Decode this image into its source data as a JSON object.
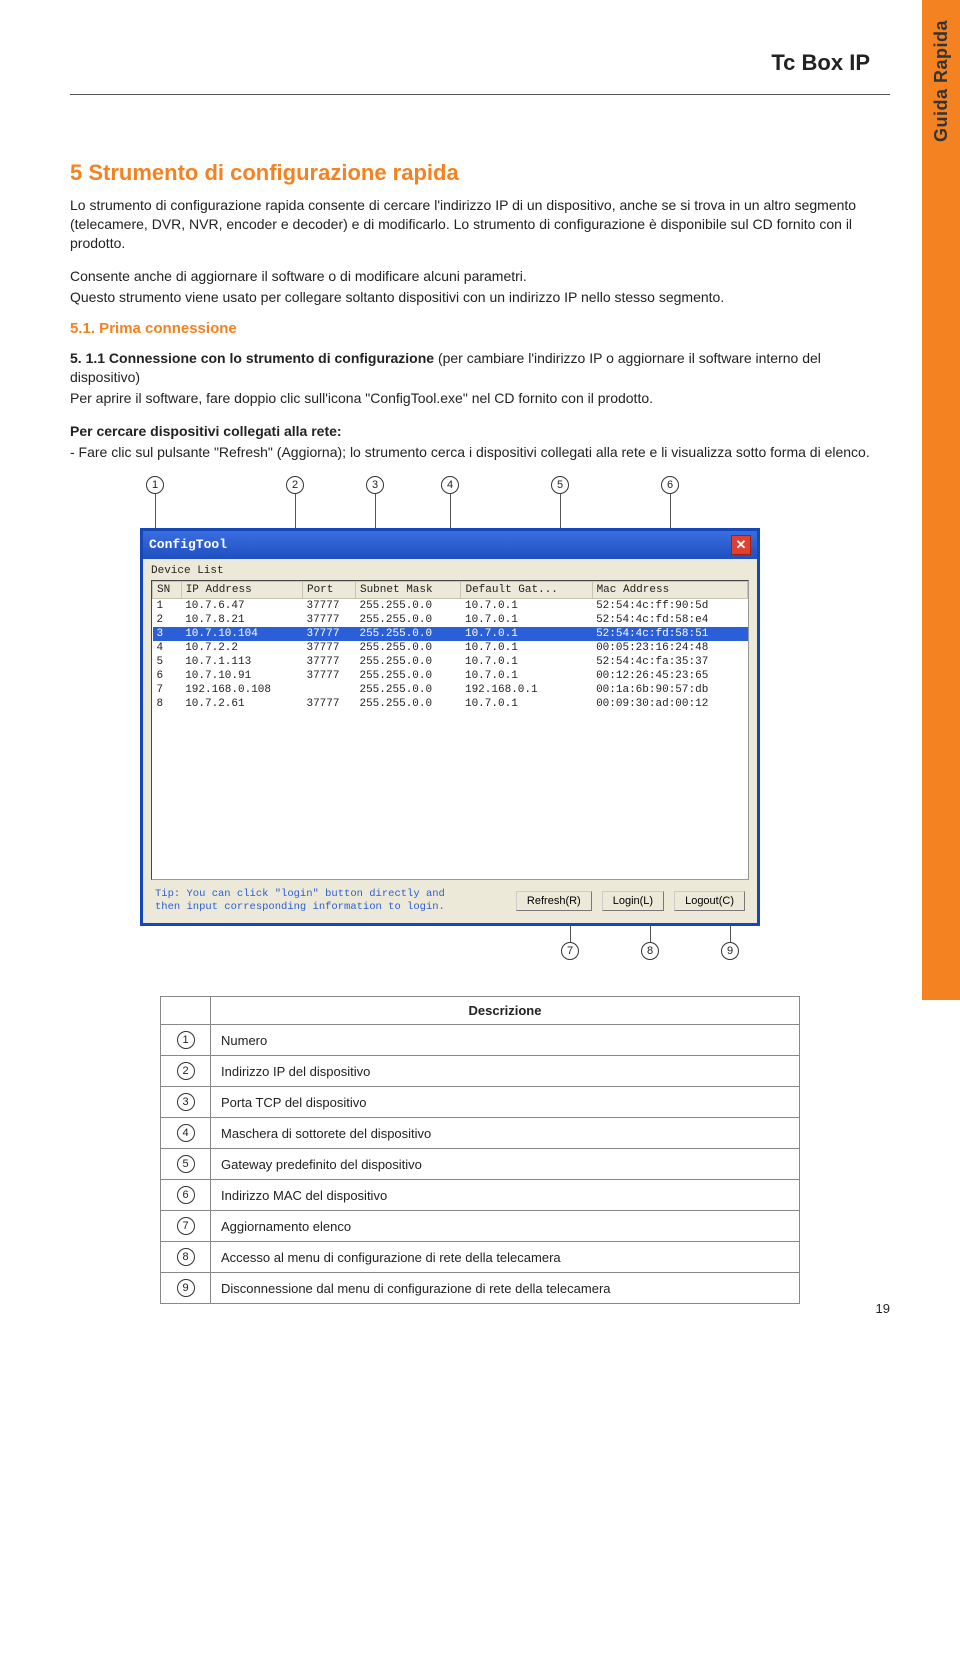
{
  "side_tab": "Guida Rapida",
  "header_title": "Tc Box IP",
  "h1": "5 Strumento di configurazione rapida",
  "p1": "Lo strumento di configurazione rapida consente di cercare l'indirizzo IP di un dispositivo, anche se si trova in un altro segmento (telecamere, DVR, NVR, encoder e decoder) e di modificarlo. Lo strumento di configurazione è disponibile sul CD fornito con il prodotto.",
  "p2": "Consente anche di aggiornare il software o di modificare alcuni parametri.",
  "p3": "Questo strumento viene usato per collegare soltanto dispositivi con un indirizzo IP nello stesso segmento.",
  "h2": "5.1. Prima connessione",
  "p4_lead": "5. 1.1 Connessione con lo strumento di configurazione",
  "p4_rest": " (per cambiare l'indirizzo IP o aggiornare il software interno del dispositivo)",
  "p5": "Per aprire il software, fare doppio clic sull'icona \"ConfigTool.exe\" nel CD fornito con il prodotto.",
  "p6_lead": "Per cercare dispositivi collegati alla rete:",
  "p6_rest": "- Fare clic sul pulsante \"Refresh\" (Aggiorna); lo strumento cerca i dispositivi collegati alla rete e li visualizza sotto forma di elenco.",
  "callouts_top": [
    "1",
    "2",
    "3",
    "4",
    "5",
    "6"
  ],
  "config_window": {
    "title": "ConfigTool",
    "list_label": "Device List",
    "headers": [
      "SN",
      "IP Address",
      "Port",
      "Subnet Mask",
      "Default Gat...",
      "Mac Address"
    ],
    "rows": [
      {
        "sn": "1",
        "ip": "10.7.6.47",
        "port": "37777",
        "mask": "255.255.0.0",
        "gw": "10.7.0.1",
        "mac": "52:54:4c:ff:90:5d"
      },
      {
        "sn": "2",
        "ip": "10.7.8.21",
        "port": "37777",
        "mask": "255.255.0.0",
        "gw": "10.7.0.1",
        "mac": "52:54:4c:fd:58:e4"
      },
      {
        "sn": "3",
        "ip": "10.7.10.104",
        "port": "37777",
        "mask": "255.255.0.0",
        "gw": "10.7.0.1",
        "mac": "52:54:4c:fd:58:51",
        "selected": true
      },
      {
        "sn": "4",
        "ip": "10.7.2.2",
        "port": "37777",
        "mask": "255.255.0.0",
        "gw": "10.7.0.1",
        "mac": "00:05:23:16:24:48"
      },
      {
        "sn": "5",
        "ip": "10.7.1.113",
        "port": "37777",
        "mask": "255.255.0.0",
        "gw": "10.7.0.1",
        "mac": "52:54:4c:fa:35:37"
      },
      {
        "sn": "6",
        "ip": "10.7.10.91",
        "port": "37777",
        "mask": "255.255.0.0",
        "gw": "10.7.0.1",
        "mac": "00:12:26:45:23:65"
      },
      {
        "sn": "7",
        "ip": "192.168.0.108",
        "port": "",
        "mask": "255.255.0.0",
        "gw": "192.168.0.1",
        "mac": "00:1a:6b:90:57:db"
      },
      {
        "sn": "8",
        "ip": "10.7.2.61",
        "port": "37777",
        "mask": "255.255.0.0",
        "gw": "10.7.0.1",
        "mac": "00:09:30:ad:00:12"
      }
    ],
    "tip": "Tip: You can click \"login\" button directly and then input corresponding information to login.",
    "buttons": {
      "refresh": "Refresh(R)",
      "login": "Login(L)",
      "logout": "Logout(C)"
    }
  },
  "callouts_bot": [
    "7",
    "8",
    "9"
  ],
  "desc_table": {
    "header": "Descrizione",
    "rows": [
      {
        "n": "1",
        "d": "Numero"
      },
      {
        "n": "2",
        "d": "Indirizzo IP del dispositivo"
      },
      {
        "n": "3",
        "d": "Porta TCP del dispositivo"
      },
      {
        "n": "4",
        "d": "Maschera di sottorete del dispositivo"
      },
      {
        "n": "5",
        "d": "Gateway predefinito del dispositivo"
      },
      {
        "n": "6",
        "d": "Indirizzo MAC del dispositivo"
      },
      {
        "n": "7",
        "d": "Aggiornamento elenco"
      },
      {
        "n": "8",
        "d": "Accesso al menu di configurazione di rete della telecamera"
      },
      {
        "n": "9",
        "d": "Disconnessione dal menu di configurazione di rete della telecamera"
      }
    ]
  },
  "page_number": "19"
}
